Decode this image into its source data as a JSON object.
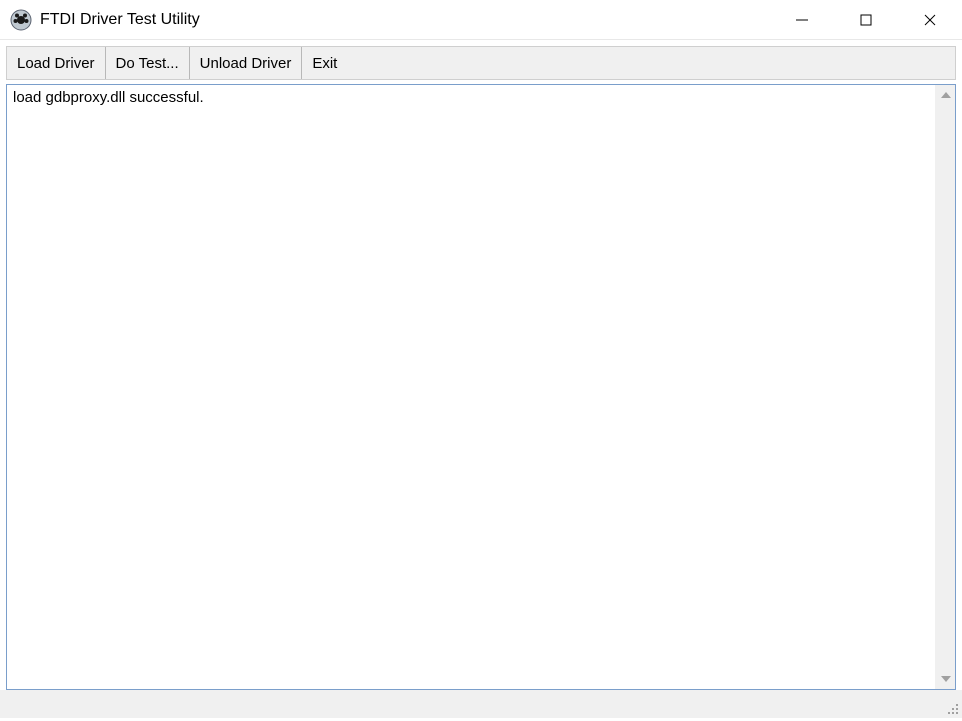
{
  "window": {
    "title": "FTDI Driver Test Utility"
  },
  "toolbar": {
    "load_driver": "Load Driver",
    "do_test": "Do Test...",
    "unload_driver": "Unload Driver",
    "exit": "Exit"
  },
  "output": {
    "text": "load gdbproxy.dll successful."
  }
}
